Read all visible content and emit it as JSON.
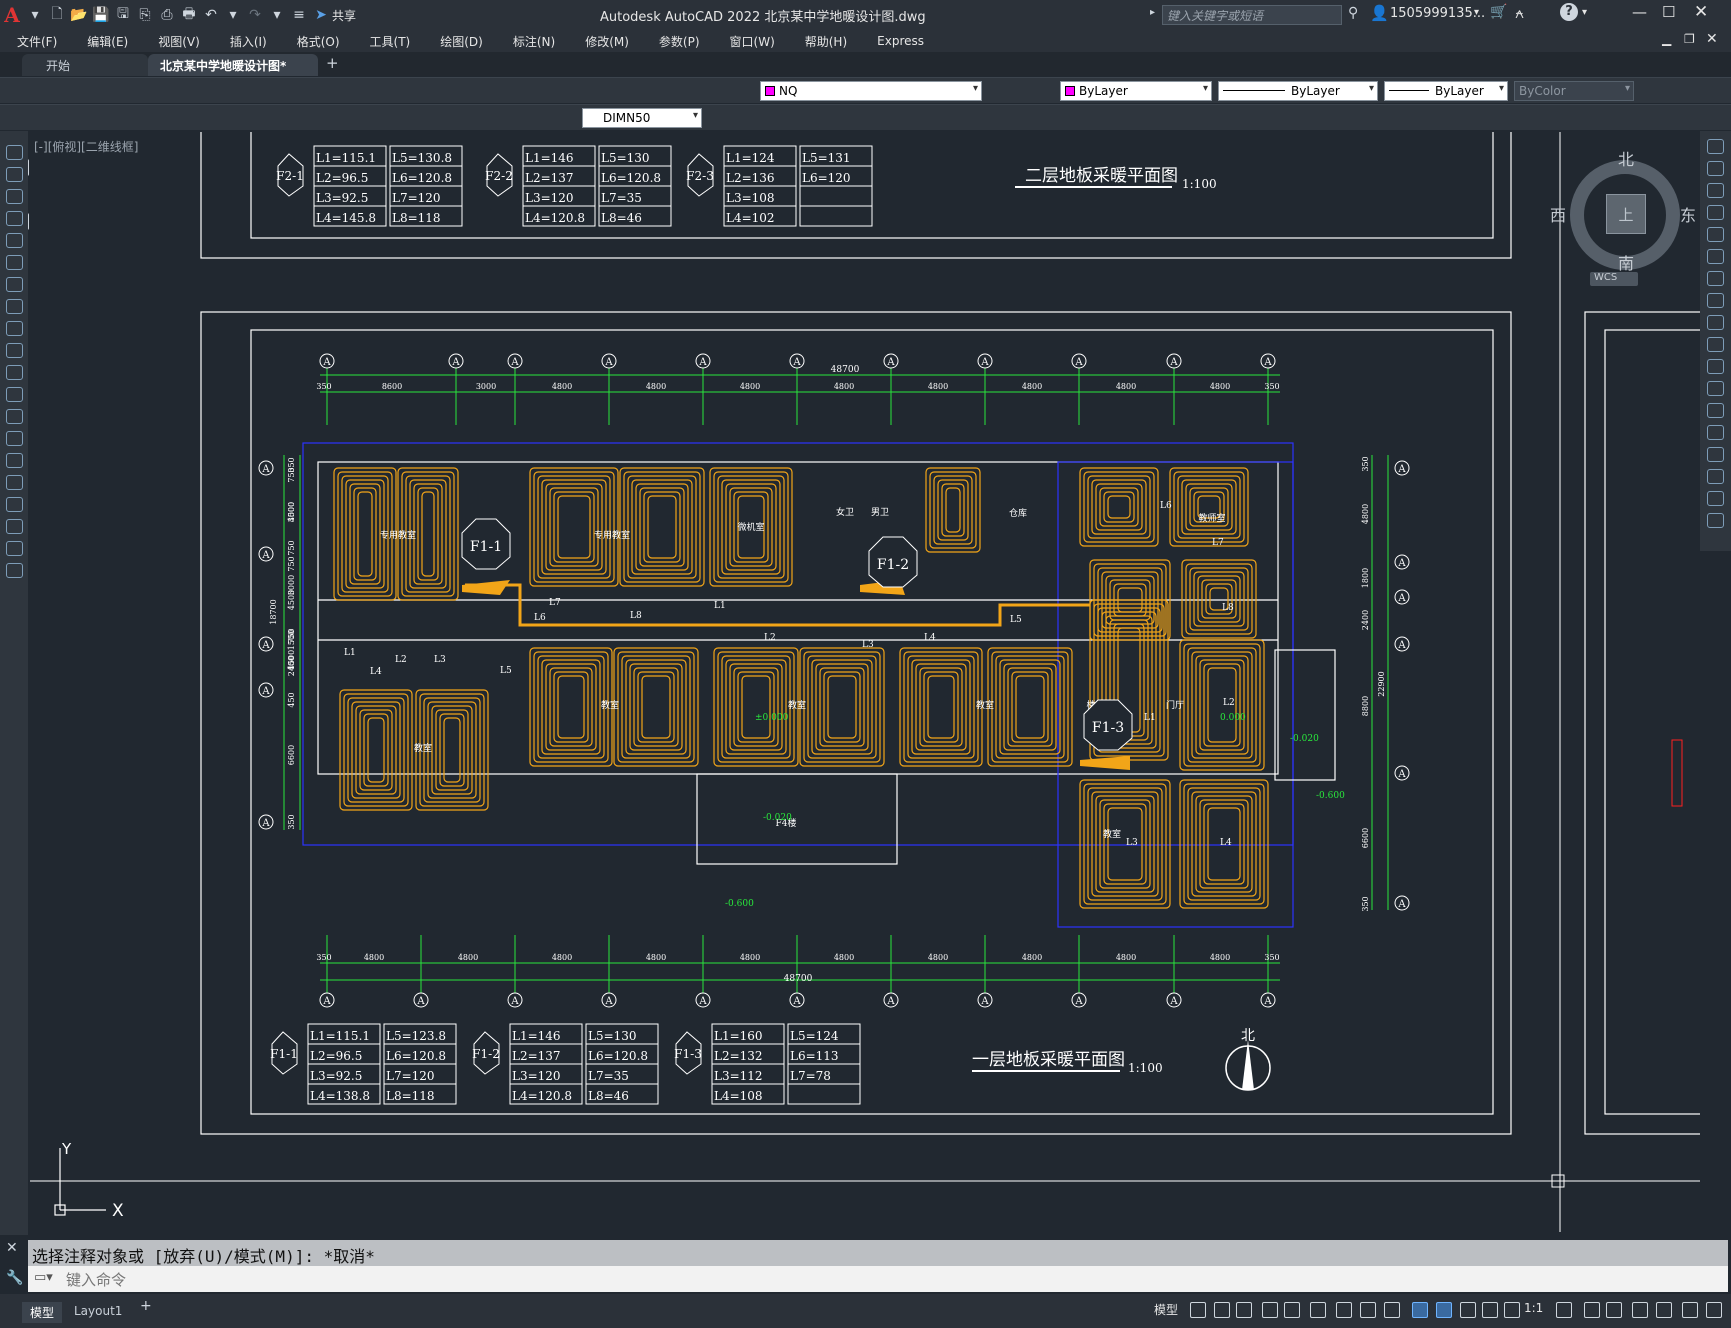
{
  "window": {
    "title": "Autodesk AutoCAD 2022    北京某中学地暖设计图.dwg",
    "share_label": "共享",
    "search_placeholder": "键入关键字或短语",
    "user": "1505999135...",
    "help_icon": "question-icon"
  },
  "menu": [
    "文件(F)",
    "编辑(E)",
    "视图(V)",
    "插入(I)",
    "格式(O)",
    "工具(T)",
    "绘图(D)",
    "标注(N)",
    "修改(M)",
    "参数(P)",
    "窗口(W)",
    "帮助(H)",
    "Express"
  ],
  "tabs": {
    "start": "开始",
    "active": "北京某中学地暖设计图*"
  },
  "toolbar": {
    "layer_name": "NQ",
    "color": "ByLayer",
    "linetype": "ByLayer",
    "lineweight": "ByLayer",
    "plotstyle": "ByColor",
    "dimstyle": "DIMN50",
    "layer_color": "#ff00ff"
  },
  "viewport_label": "[-][俯视][二维线框]",
  "viewcube": {
    "north": "北",
    "south": "南",
    "east": "东",
    "west": "西",
    "top": "上",
    "wcs": "WCS"
  },
  "drawing": {
    "upper_title": "二层地板采暖平面图",
    "upper_scale": "1:100",
    "lower_title": "一层地板采暖平面图",
    "lower_scale": "1:100",
    "north": "北",
    "overall_dim": "48700",
    "top_dims": [
      "350",
      "8600",
      "3000",
      "4800",
      "4800",
      "4800",
      "4800",
      "4800",
      "4800",
      "4800",
      "4800",
      "350"
    ],
    "bottom_dims": [
      "350",
      "4800",
      "4800",
      "4800",
      "4800",
      "4800",
      "4800",
      "4800",
      "4800",
      "4800",
      "4800",
      "350"
    ],
    "left_dims": [
      "350",
      "750",
      "4500",
      "3000",
      "750",
      "750",
      "3000",
      "4500",
      "18700",
      "1500",
      "750",
      "4500",
      "2400",
      "450",
      "6600",
      "350"
    ],
    "right_dims": [
      "350",
      "4800",
      "1800",
      "2400",
      "22900",
      "8800",
      "6600",
      "350"
    ],
    "axis_label": "A",
    "rooms": [
      "专用教室",
      "专用教室",
      "微机室",
      "女卫",
      "男卫",
      "仓库",
      "教师室",
      "教室",
      "教室",
      "教室",
      "教室",
      "教室",
      "门厅",
      "楼梯间",
      "F4楼"
    ],
    "level_marks": [
      "-0.020",
      "±0.000",
      "-0.600",
      "-0.020",
      "-0.600",
      "0.000",
      "0.020",
      "-0.600"
    ],
    "zone_tags": [
      "F1-1",
      "F1-2",
      "F1-3"
    ],
    "loop_labels": [
      "L1",
      "L2",
      "L3",
      "L4",
      "L5",
      "L6",
      "L7",
      "L8"
    ],
    "tables_upper": [
      {
        "tag": "F2-1",
        "col1": [
          "L1=115.1",
          "L2=96.5",
          "L3=92.5",
          "L4=145.8"
        ],
        "col2": [
          "L5=130.8",
          "L6=120.8",
          "L7=120",
          "L8=118"
        ]
      },
      {
        "tag": "F2-2",
        "col1": [
          "L1=146",
          "L2=137",
          "L3=120",
          "L4=120.8"
        ],
        "col2": [
          "L5=130",
          "L6=120.8",
          "L7=35",
          "L8=46"
        ]
      },
      {
        "tag": "F2-3",
        "col1": [
          "L1=124",
          "L2=136",
          "L3=108",
          "L4=102"
        ],
        "col2": [
          "L5=131",
          "L6=120",
          "",
          ""
        ]
      }
    ],
    "tables_lower": [
      {
        "tag": "F1-1",
        "col1": [
          "L1=115.1",
          "L2=96.5",
          "L3=92.5",
          "L4=138.8"
        ],
        "col2": [
          "L5=123.8",
          "L6=120.8",
          "L7=120",
          "L8=118"
        ]
      },
      {
        "tag": "F1-2",
        "col1": [
          "L1=146",
          "L2=137",
          "L3=120",
          "L4=120.8"
        ],
        "col2": [
          "L5=130",
          "L6=120.8",
          "L7=35",
          "L8=46"
        ]
      },
      {
        "tag": "F1-3",
        "col1": [
          "L1=160",
          "L2=132",
          "L3=112",
          "L4=108"
        ],
        "col2": [
          "L5=124",
          "L6=113",
          "L7=78",
          ""
        ]
      }
    ]
  },
  "ucs": {
    "x": "X",
    "y": "Y"
  },
  "command": {
    "history": "选择注释对象或 [放弃(U)/模式(M)]: *取消*",
    "placeholder": "键入命令"
  },
  "status": {
    "model_tab": "模型",
    "layout_tab": "Layout1",
    "model_label": "模型",
    "scale": "1:1"
  }
}
